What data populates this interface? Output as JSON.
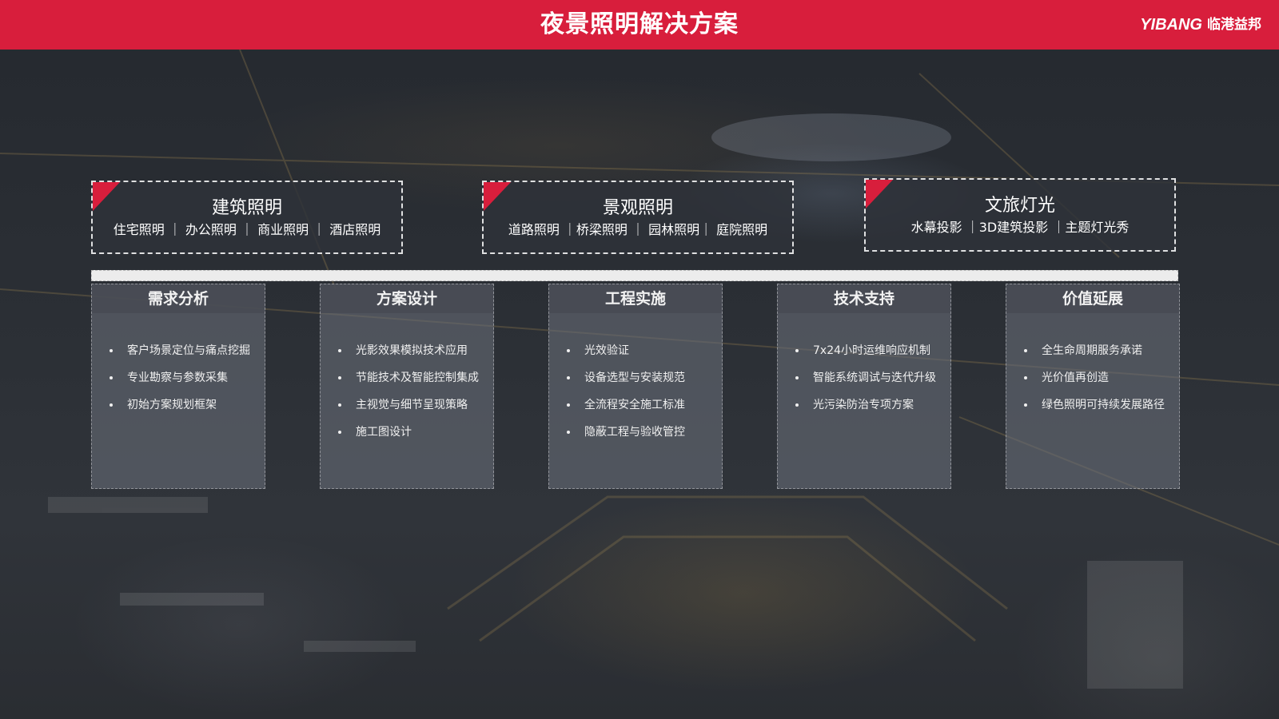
{
  "header": {
    "title": "夜景照明解决方案",
    "logo_mark": "YIBANG",
    "logo_cn": "临港益邦",
    "bg_color": "#d81e3c"
  },
  "categories": [
    {
      "title": "建筑照明",
      "subtitle": "住宅照明 ｜ 办公照明 ｜ 商业照明 ｜ 酒店照明"
    },
    {
      "title": "景观照明",
      "subtitle": "道路照明 ｜桥梁照明 ｜ 园林照明｜ 庭院照明"
    },
    {
      "title": "文旅灯光",
      "subtitle": "水幕投影 ｜3D建筑投影 ｜主题灯光秀"
    }
  ],
  "stages": [
    {
      "title": "需求分析",
      "items": [
        "客户场景定位与痛点挖掘",
        "专业勘察与参数采集",
        "初始方案规划框架"
      ]
    },
    {
      "title": "方案设计",
      "items": [
        "光影效果模拟技术应用",
        "节能技术及智能控制集成",
        "主视觉与细节呈现策略",
        "施工图设计"
      ]
    },
    {
      "title": "工程实施",
      "items": [
        "光效验证",
        "设备选型与安装规范",
        "全流程安全施工标准",
        "隐蔽工程与验收管控"
      ]
    },
    {
      "title": "技术支持",
      "items": [
        "7x24小时运维响应机制",
        "智能系统调试与迭代升级",
        "光污染防治专项方案"
      ]
    },
    {
      "title": "价值延展",
      "items": [
        "全生命周期服务承诺",
        "光价值再创造",
        "绿色照明可持续发展路径"
      ]
    }
  ],
  "accent_color": "#d81e3c"
}
